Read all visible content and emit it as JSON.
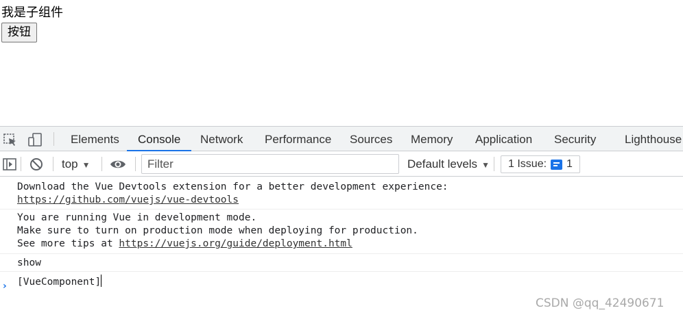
{
  "page": {
    "child_text": "我是子组件",
    "button_label": "按钮"
  },
  "devtools": {
    "tabs": [
      {
        "label": "Elements"
      },
      {
        "label": "Console"
      },
      {
        "label": "Network"
      },
      {
        "label": "Performance"
      },
      {
        "label": "Sources"
      },
      {
        "label": "Memory"
      },
      {
        "label": "Application"
      },
      {
        "label": "Security"
      },
      {
        "label": "Lighthouse"
      }
    ],
    "active_tab": "Console",
    "toolbar": {
      "context": "top",
      "filter_placeholder": "Filter",
      "levels": "Default levels",
      "issues_label": "1 Issue:",
      "issues_count": "1"
    },
    "messages": {
      "m1_line1": "Download the Vue Devtools extension for a better development experience:",
      "m1_link": "https://github.com/vuejs/vue-devtools",
      "m2_line1": "You are running Vue in development mode.",
      "m2_line2": "Make sure to turn on production mode when deploying for production.",
      "m2_line3_prefix": "See more tips at ",
      "m2_link": "https://vuejs.org/guide/deployment.html",
      "m3": "show",
      "m4": "[VueComponent]"
    }
  },
  "watermark": "CSDN @qq_42490671",
  "colors": {
    "accent": "#1a73e8",
    "toolbar_bg": "#f1f3f4"
  }
}
